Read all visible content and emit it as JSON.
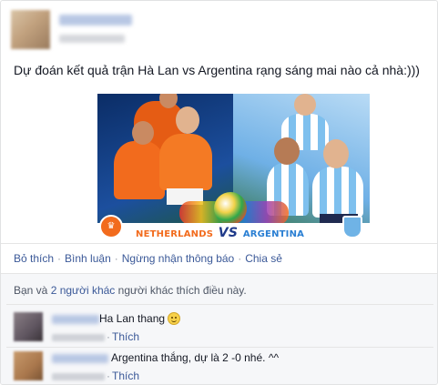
{
  "post": {
    "text": "Dự đoán kết quả trận Hà Lan vs Argentina rạng sáng mai nào cả nhà:)))",
    "photo": {
      "banner_left": "NETHERLANDS",
      "banner_vs": "VS",
      "banner_right": "ARGENTINA"
    }
  },
  "actions": {
    "like": "Bỏ thích",
    "comment": "Bình luận",
    "unfollow": "Ngừng nhận thông báo",
    "share": "Chia sẻ",
    "separator": "·"
  },
  "likes": {
    "prefix": "Bạn và ",
    "others_link": "2 người khác",
    "suffix": " người khác thích điều này."
  },
  "comments": [
    {
      "text": "Ha Lan thang",
      "like_label": "Thích",
      "has_emoji": true
    },
    {
      "text": "Argentina thắng, dự là 2 -0 nhé. ^^",
      "like_label": "Thích",
      "has_emoji": false
    }
  ],
  "icons": {
    "smiley": "smiley-emoji-icon",
    "logo_left": "knvb-lion-icon",
    "logo_right": "afa-crest-icon"
  }
}
